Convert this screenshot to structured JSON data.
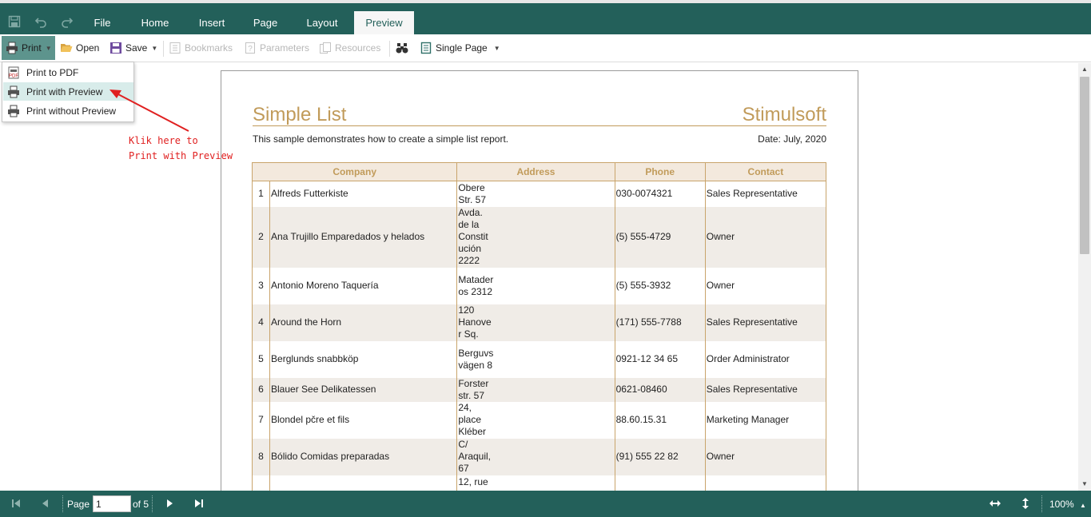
{
  "menubar": {
    "tabs": [
      {
        "label": "File"
      },
      {
        "label": "Home"
      },
      {
        "label": "Insert"
      },
      {
        "label": "Page"
      },
      {
        "label": "Layout"
      },
      {
        "label": "Preview"
      }
    ],
    "active_tab": "Preview"
  },
  "toolbar": {
    "print_label": "Print",
    "open_label": "Open",
    "save_label": "Save",
    "bookmarks_label": "Bookmarks",
    "parameters_label": "Parameters",
    "resources_label": "Resources",
    "view_mode_label": "Single Page"
  },
  "print_menu": {
    "items": [
      {
        "label": "Print to PDF"
      },
      {
        "label": "Print with Preview"
      },
      {
        "label": "Print without Preview"
      }
    ],
    "highlighted": "Print with Preview"
  },
  "annotation": {
    "text": "Klik here to\nPrint with Preview",
    "color": "#e02020"
  },
  "report": {
    "title": "Simple List",
    "brand": "Stimulsoft",
    "description": "This sample demonstrates how to create a simple list report.",
    "date": "Date: July, 2020",
    "columns": [
      "Company",
      "Address",
      "Phone",
      "Contact"
    ],
    "rows": [
      {
        "num": "1",
        "company": "Alfreds Futterkiste",
        "address": "Obere\nStr. 57",
        "phone": "030-0074321",
        "contact": "Sales Representative"
      },
      {
        "num": "2",
        "company": "Ana Trujillo Emparedados y helados",
        "address": "Avda.\nde la\nConstit\nución\n2222",
        "phone": "(5) 555-4729",
        "contact": "Owner"
      },
      {
        "num": "3",
        "company": "Antonio Moreno Taquería",
        "address": "Matader\nos 2312",
        "phone": "(5) 555-3932",
        "contact": "Owner"
      },
      {
        "num": "4",
        "company": "Around the Horn",
        "address": "120\nHanove\nr Sq.",
        "phone": "(171) 555-7788",
        "contact": "Sales Representative"
      },
      {
        "num": "5",
        "company": "Berglunds snabbköp",
        "address": "Berguvs\nvägen 8",
        "phone": "0921-12 34 65",
        "contact": "Order Administrator"
      },
      {
        "num": "6",
        "company": "Blauer See Delikatessen",
        "address": "Forster\nstr. 57",
        "phone": "0621-08460",
        "contact": "Sales Representative"
      },
      {
        "num": "7",
        "company": "Blondel pčre et fils",
        "address": "24,\nplace\nKléber",
        "phone": "88.60.15.31",
        "contact": "Marketing Manager"
      },
      {
        "num": "8",
        "company": "Bólido Comidas preparadas",
        "address": "C/\nAraquil,\n67",
        "phone": "(91) 555 22 82",
        "contact": "Owner"
      },
      {
        "num": "",
        "company": "",
        "address": "12, rue",
        "phone": "",
        "contact": ""
      }
    ],
    "accent_color": "#c19b5a"
  },
  "statusbar": {
    "page_label": "Page",
    "page_value": "1",
    "of_label": "of 5",
    "zoom_label": "100%"
  },
  "colors": {
    "theme": "#23605a",
    "pressed": "#5d948d",
    "menu_highlight": "#d8ecea"
  }
}
